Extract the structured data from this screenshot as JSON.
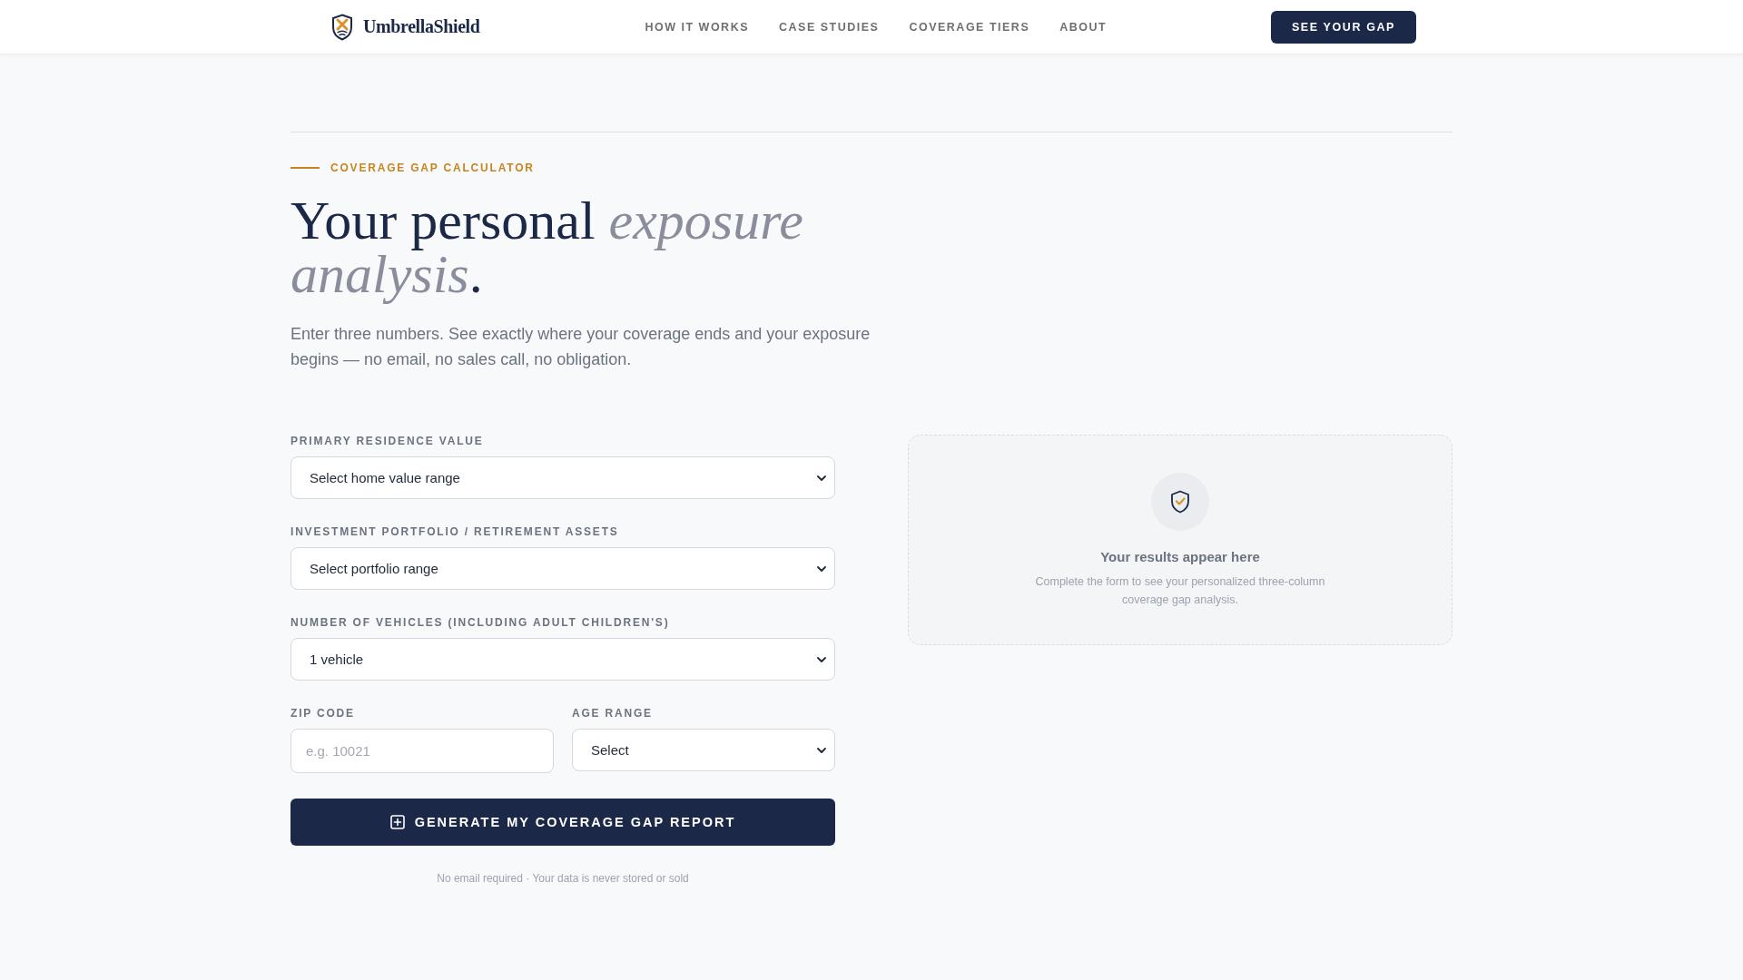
{
  "header": {
    "brand": "UmbrellaShield",
    "nav": [
      "HOW IT WORKS",
      "CASE STUDIES",
      "COVERAGE TIERS",
      "ABOUT"
    ],
    "cta": "SEE YOUR GAP"
  },
  "hero": {
    "eyebrow": "COVERAGE GAP CALCULATOR",
    "title": "Your personal *exposure analysis*.",
    "subtitle": "Enter three numbers. See exactly where your coverage ends and your exposure begins — no email, no sales call, no obligation."
  },
  "form": {
    "fields": [
      {
        "kind": "select",
        "label": "PRIMARY RESIDENCE VALUE",
        "value": "Select home value range"
      },
      {
        "kind": "select",
        "label": "INVESTMENT PORTFOLIO / RETIREMENT ASSETS",
        "value": "Select portfolio range"
      },
      {
        "kind": "select",
        "label": "NUMBER OF VEHICLES (INCLUDING ADULT CHILDREN'S)",
        "value": "1 vehicle"
      }
    ],
    "row": [
      {
        "kind": "input",
        "label": "ZIP CODE",
        "placeholder": "e.g. 10021"
      },
      {
        "kind": "select",
        "label": "AGE RANGE",
        "value": "Select"
      }
    ],
    "submit": "GENERATE MY COVERAGE GAP REPORT",
    "note": "No email required · Your data is never stored or sold"
  },
  "results": {
    "title": "Your results appear here",
    "description": "Complete the form to see your personalized three-column coverage gap analysis."
  }
}
